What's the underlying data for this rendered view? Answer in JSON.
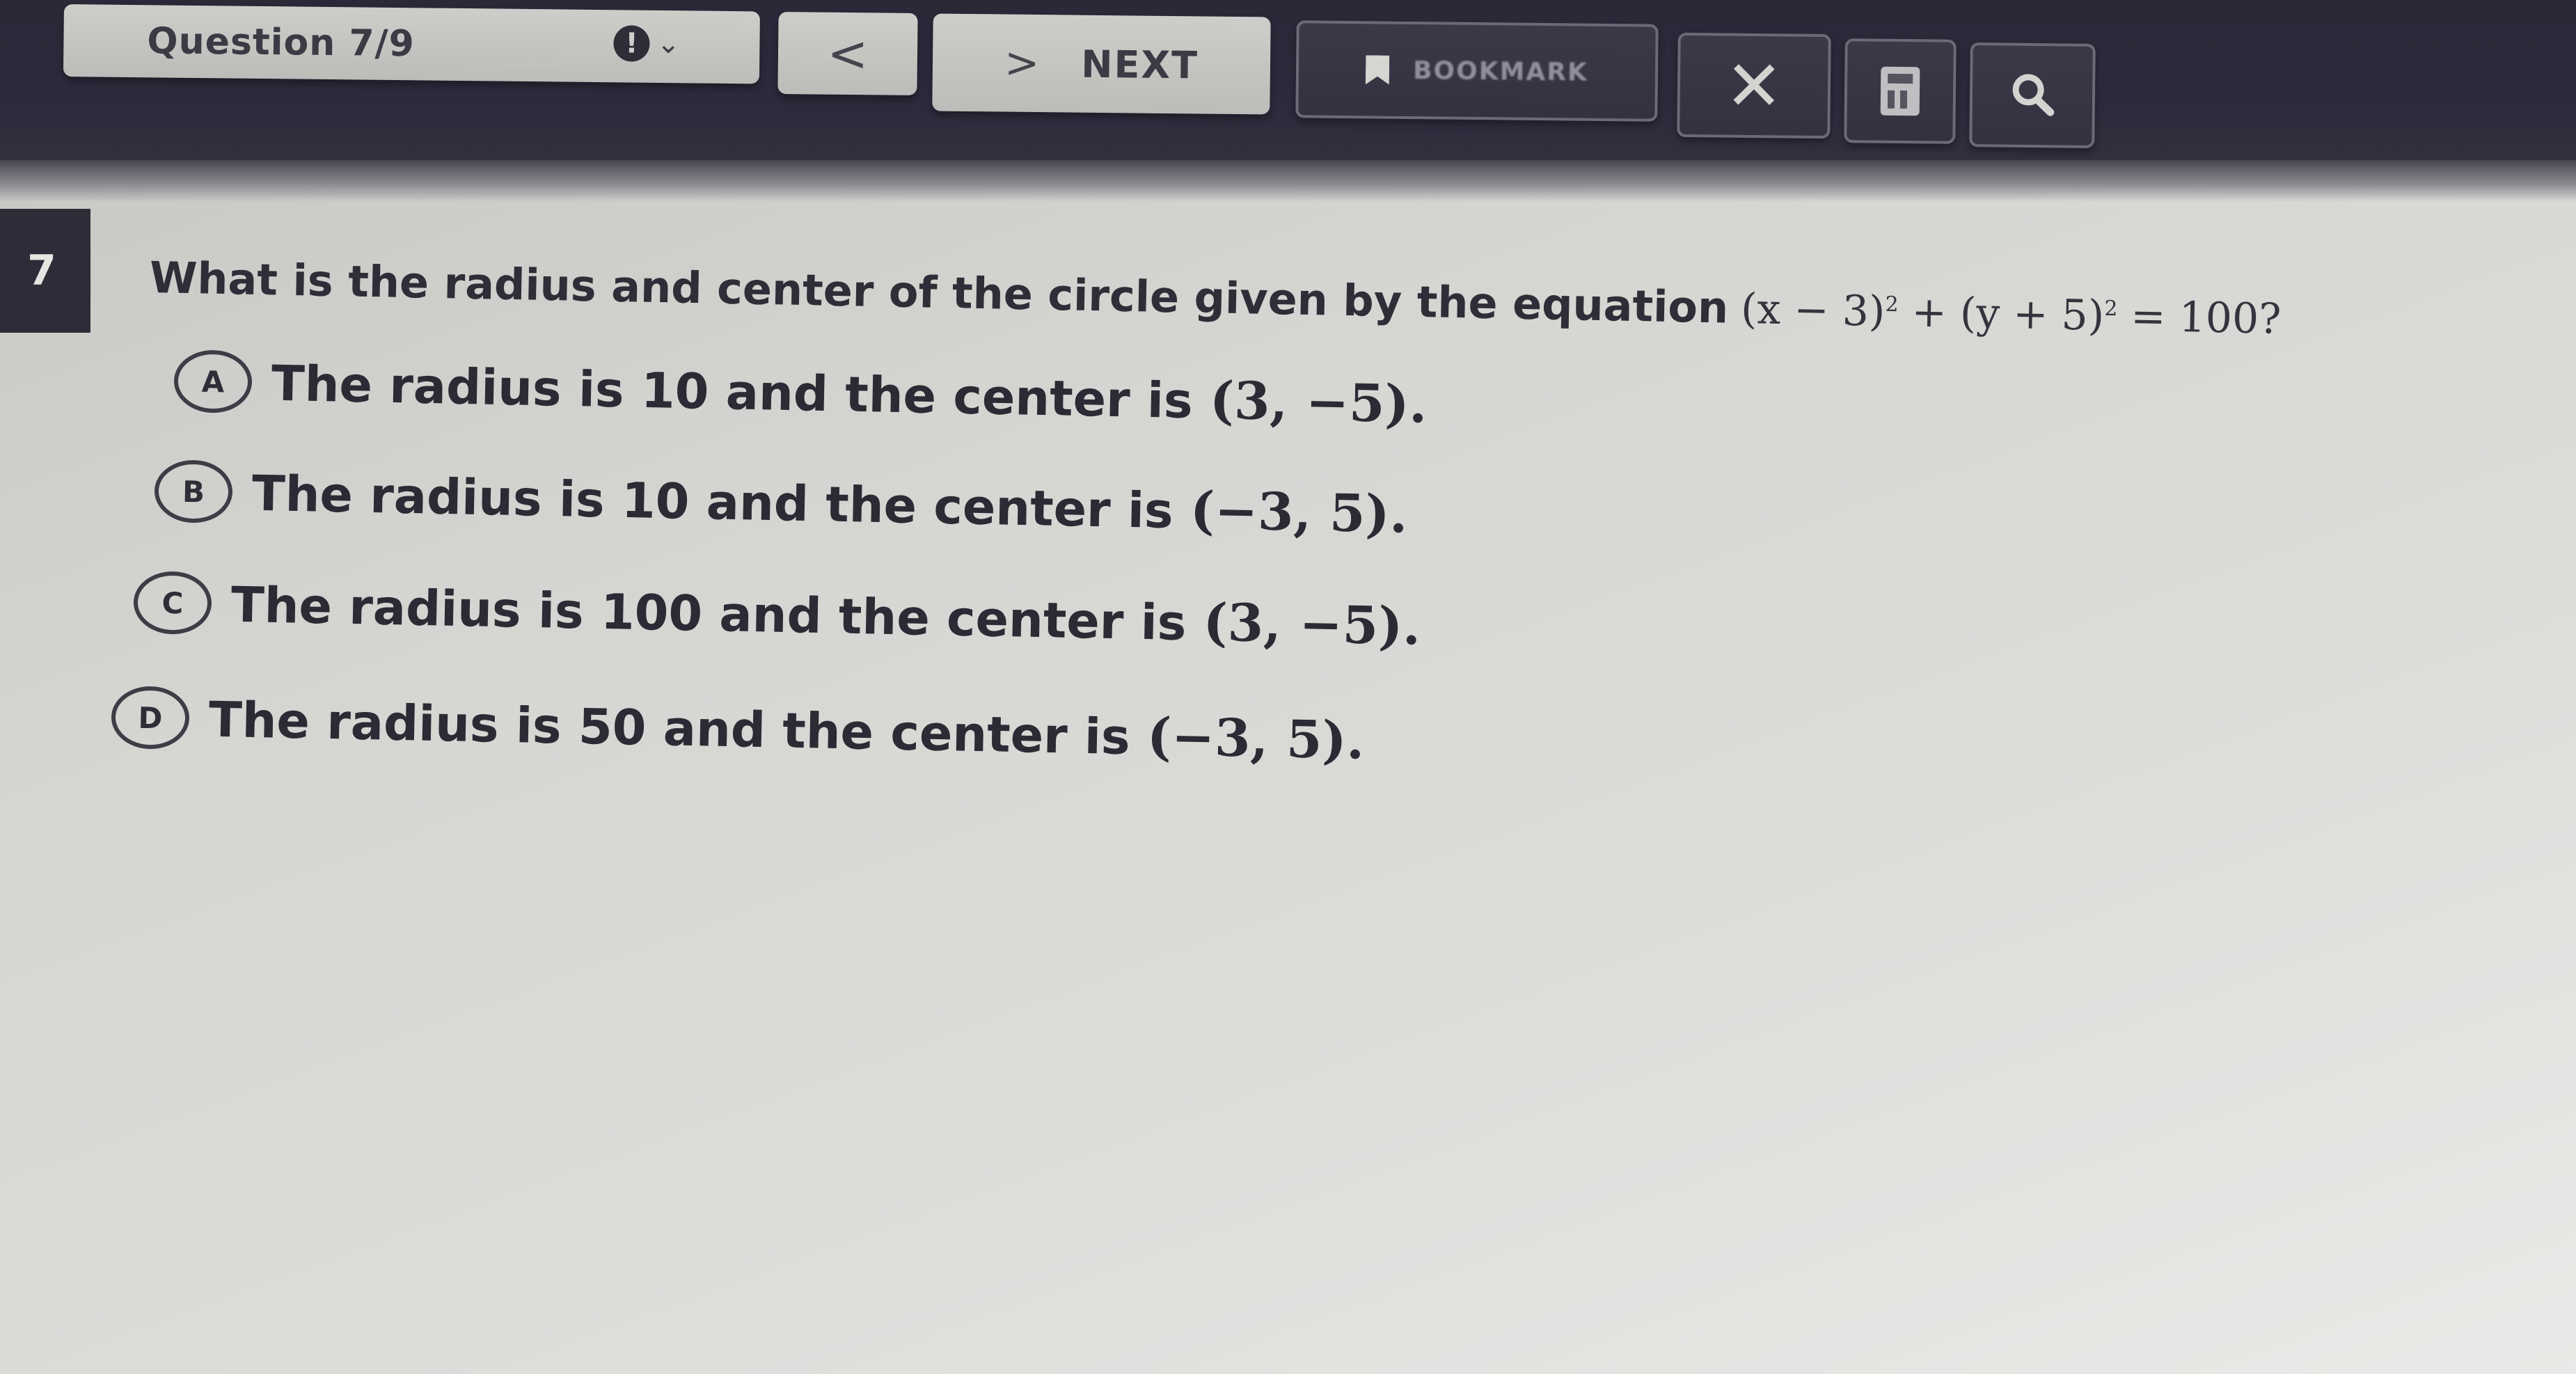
{
  "toolbar": {
    "question_label": "Question 7/9",
    "flag_symbol": "!",
    "flag_chevron": "⌄",
    "prev_glyph": "<",
    "next_glyph": ">",
    "next_label": "NEXT",
    "bookmark_label": "BOOKMARK",
    "close_glyph": "✕",
    "icons": [
      "flag-icon",
      "chevron-down-icon",
      "bookmark-icon",
      "close-icon",
      "calculator-icon",
      "search-icon"
    ]
  },
  "question": {
    "number": "7",
    "prompt": "What is the radius and center of the circle given by the equation",
    "equation_part1": "(x − 3)",
    "equation_exp1": "2",
    "equation_plus": "+",
    "equation_part2": "(y + 5)",
    "equation_exp2": "2",
    "equation_rhs": "= 100?",
    "choices": [
      {
        "letter": "A",
        "text": "The radius is 10 and the center is",
        "point": "(3, −5)."
      },
      {
        "letter": "B",
        "text": "The radius is 10 and the center is",
        "point": "(−3, 5)."
      },
      {
        "letter": "C",
        "text": "The radius is 100 and the center is",
        "point": "(3, −5)."
      },
      {
        "letter": "D",
        "text": "The radius is 50 and the center is",
        "point": "(−3, 5)."
      }
    ]
  },
  "colors": {
    "toolbar_bg": "#2c2a3b",
    "button_light": "#cecdca",
    "text_dark": "#2e2e38",
    "page_bg": "#d6d5d2"
  }
}
